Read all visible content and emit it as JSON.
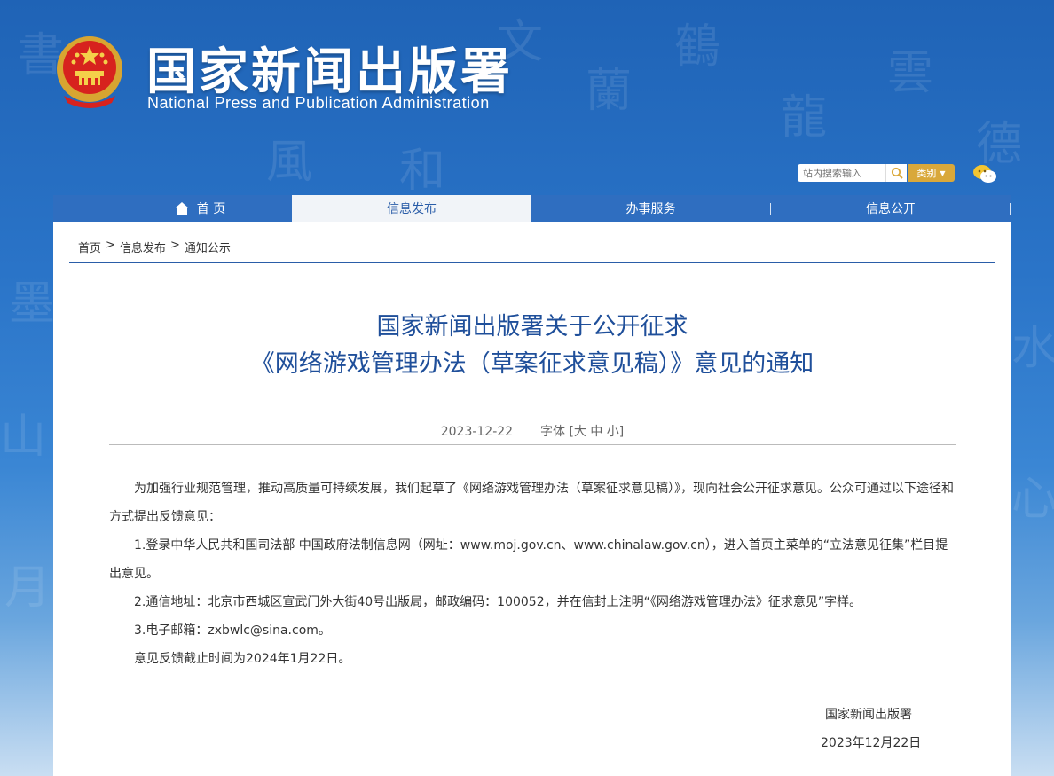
{
  "header": {
    "title": "国家新闻出版署",
    "subtitle": "National Press and Publication Administration",
    "search_placeholder": "站内搜索输入",
    "category_label": "类别"
  },
  "nav": {
    "items": [
      {
        "label": "首 页",
        "icon": "home-icon"
      },
      {
        "label": "信息发布",
        "active": true
      },
      {
        "label": "办事服务"
      },
      {
        "label": "信息公开"
      }
    ]
  },
  "breadcrumb": [
    "首页",
    ">",
    "信息发布",
    ">",
    "通知公示"
  ],
  "article": {
    "title_line1": "国家新闻出版署关于公开征求",
    "title_line2": "《网络游戏管理办法（草案征求意见稿）》意见的通知",
    "date": "2023-12-22",
    "font_size_label": "字体 [大 中 小]",
    "paragraphs": [
      "为加强行业规范管理，推动高质量可持续发展，我们起草了《网络游戏管理办法（草案征求意见稿）》，现向社会公开征求意见。公众可通过以下途径和方式提出反馈意见：",
      "1.登录中华人民共和国司法部 中国政府法制信息网（网址：www.moj.gov.cn、www.chinalaw.gov.cn），进入首页主菜单的“立法意见征集”栏目提出意见。",
      "2.通信地址：北京市西城区宣武门外大街40号出版局，邮政编码：100052，并在信封上注明“《网络游戏管理办法》征求意见”字样。",
      "3.电子邮箱：zxbwlc@sina.com。",
      "意见反馈截止时间为2024年1月22日。"
    ],
    "signature_org": "国家新闻出版署",
    "signature_date": "2023年12月22日"
  },
  "colors": {
    "header_blue": "#1f63b6",
    "nav_blue": "#2f6ec0",
    "title_blue": "#1f4f9a",
    "category_gold": "#d9a83a"
  }
}
